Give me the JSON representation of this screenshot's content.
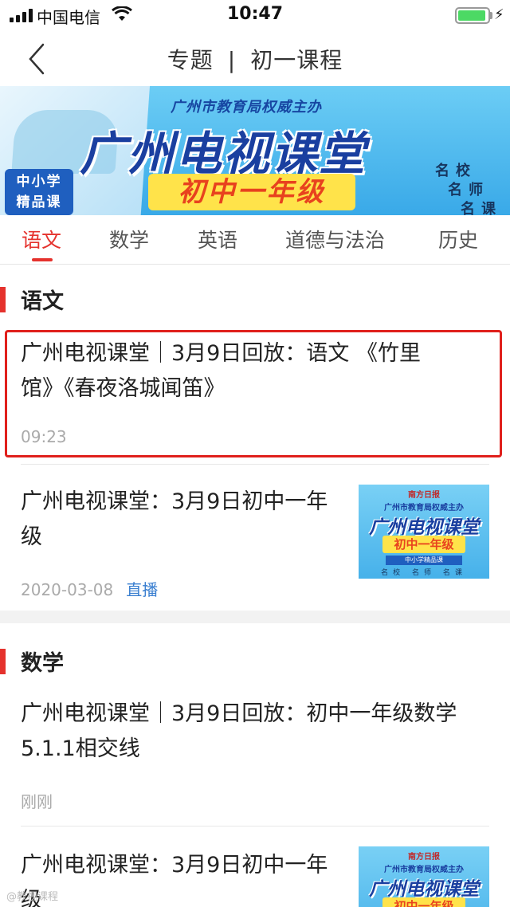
{
  "status_bar": {
    "carrier": "中国电信",
    "time": "10:47",
    "battery_level": 0.95,
    "battery_color": "#4cd964",
    "charging_icon": "⚡"
  },
  "navbar": {
    "back_icon": "chevron-left-icon",
    "title_left": "专题",
    "title_sep": "|",
    "title_right": "初一课程"
  },
  "banner": {
    "organizer": "广州市教育局权威主办",
    "title": "广州电视课堂",
    "grade": "初中一年级",
    "badge_line1": "中小学",
    "badge_line2": "精品课",
    "tag1": "名校",
    "tag2": "名师",
    "tag3": "名课"
  },
  "tabs": [
    {
      "label": "语文",
      "active": true
    },
    {
      "label": "数学",
      "active": false
    },
    {
      "label": "英语",
      "active": false
    },
    {
      "label": "道德与法治",
      "active": false
    },
    {
      "label": "历史",
      "active": false
    }
  ],
  "accent_color": "#e5322d",
  "sections": [
    {
      "title": "语文",
      "items": [
        {
          "title_line1": "广州电视课堂｜3月9日回放：语文 《竹里",
          "title_line2": "馆》《春夜洛城闻笛》",
          "meta": "09:23",
          "highlighted": true
        },
        {
          "title_line1": "广州电视课堂：3月9日初中一年",
          "title_line2": "级",
          "meta": "2020-03-08",
          "live_label": "直播",
          "thumb": {
            "publisher": "南方日报",
            "organizer": "广州市教育局权威主办",
            "title": "广州电视课堂",
            "grade": "初中一年级",
            "badge": "中小学精品课",
            "tags": "名校 名师 名课"
          }
        }
      ]
    },
    {
      "title": "数学",
      "items": [
        {
          "title_line1": "广州电视课堂｜3月9日回放：初中一年级数学",
          "title_line2": "5.1.1相交线",
          "meta": "刚刚"
        },
        {
          "title_line1": "广州电视课堂：3月9日初中一年",
          "title_line2": "级",
          "thumb": {
            "publisher": "南方日报",
            "organizer": "广州市教育局权威主办",
            "title": "广州电视课堂",
            "grade": "初中一年级"
          }
        }
      ]
    }
  ],
  "watermark": "@教视课程"
}
